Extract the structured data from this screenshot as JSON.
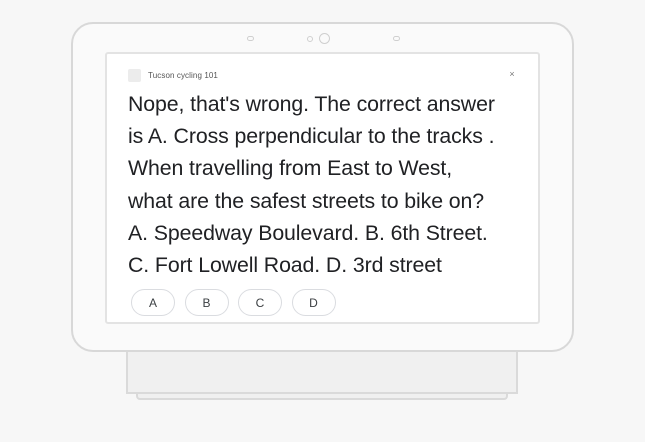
{
  "app": {
    "title": "Tucson cycling 101",
    "close_glyph": "×"
  },
  "message": {
    "lines": [
      "Nope, that's wrong. The correct answer",
      "is A. Cross perpendicular to the tracks .",
      "When travelling from East to West,",
      "what are the safest streets to bike on?",
      "A. Speedway Boulevard. B. 6th Street.",
      "C. Fort Lowell Road. D. 3rd street"
    ]
  },
  "suggestions": [
    "A",
    "B",
    "C",
    "D"
  ],
  "icons": {
    "logo": "app-logo-icon",
    "close": "close-icon"
  }
}
